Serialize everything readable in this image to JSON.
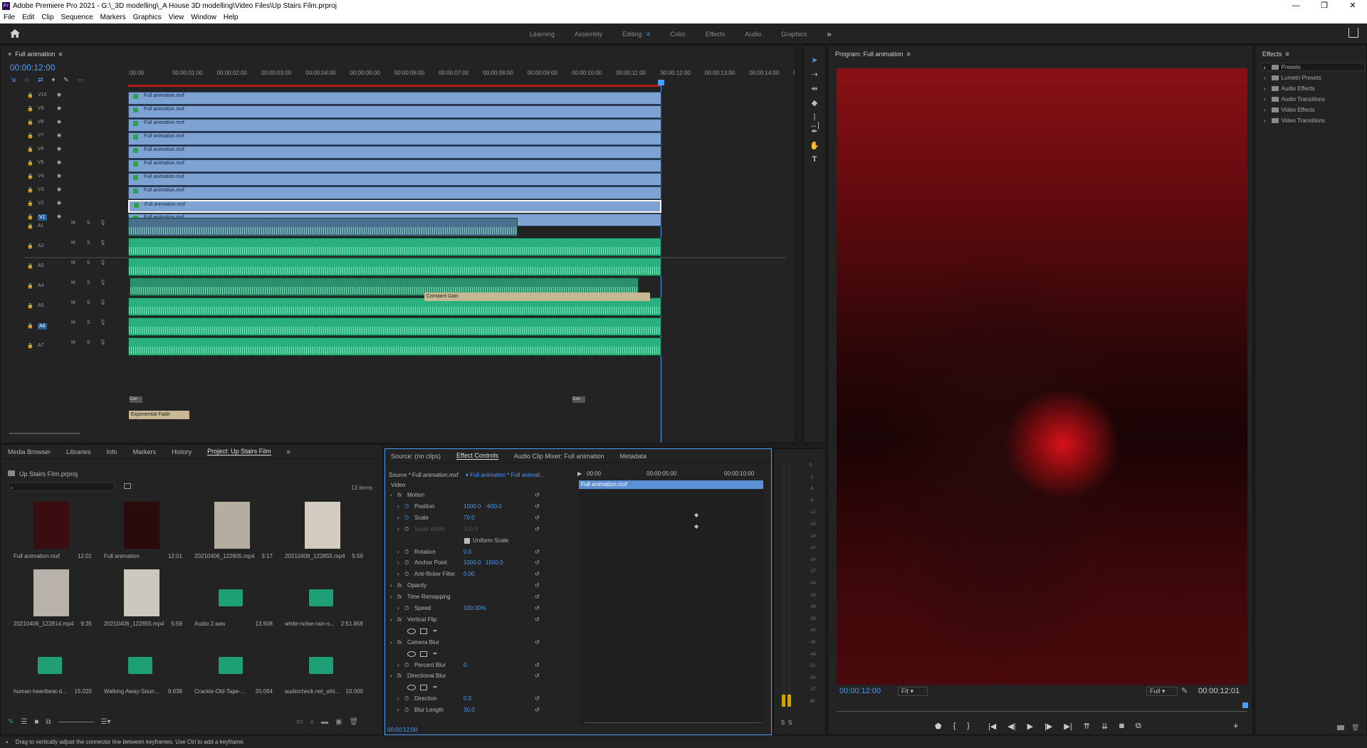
{
  "title_bar": {
    "title": "Adobe Premiere Pro 2021 - G:\\_3D modelling\\_A House 3D modelling\\Video Files\\Up Stairs Film.prproj",
    "app_badge": "Pr"
  },
  "window_controls": [
    "—",
    "❐",
    "✕"
  ],
  "menu": [
    "File",
    "Edit",
    "Clip",
    "Sequence",
    "Markers",
    "Graphics",
    "View",
    "Window",
    "Help"
  ],
  "workspaces": [
    {
      "label": "Learning"
    },
    {
      "label": "Assembly"
    },
    {
      "label": "Editing",
      "active": true
    },
    {
      "label": "Color"
    },
    {
      "label": "Effects"
    },
    {
      "label": "Audio"
    },
    {
      "label": "Graphics"
    }
  ],
  "timeline": {
    "sequence_tab": "Full animation",
    "timecode": "00:00:12:00",
    "ruler": [
      ":00:00",
      "00:00:01:00",
      "00:00:02:00",
      "00:00:03:00",
      "00:00:04:00",
      "00:00:05:00",
      "00:00:06:00",
      "00:00:07:00",
      "00:00:08:00",
      "00:00:09:00",
      "00:00:10:00",
      "00:00:11:00",
      "00:00:12:00",
      "00:00:13:00",
      "00:00:14:00",
      "00:"
    ],
    "video_tracks": [
      {
        "name": "V10",
        "clip": "Full animation.mxf"
      },
      {
        "name": "V9",
        "clip": "Full animation.mxf"
      },
      {
        "name": "V8",
        "clip": "Full animation.mxf"
      },
      {
        "name": "V7",
        "clip": "Full animation.mxf"
      },
      {
        "name": "V6",
        "clip": "Full animation.mxf"
      },
      {
        "name": "V5",
        "clip": "Full animation.mxf"
      },
      {
        "name": "V4",
        "clip": "Full animation.mxf"
      },
      {
        "name": "V3",
        "clip": "Full animation.mxf"
      },
      {
        "name": "V2",
        "clip": "Full animation.mxf"
      },
      {
        "name": "V1",
        "clip": "Full animation.mxf"
      }
    ],
    "audio_tracks": [
      "A1",
      "A2",
      "A3",
      "A4",
      "A5",
      "A6",
      "A7"
    ],
    "track_buttons": {
      "mute": "M",
      "solo": "S"
    },
    "transitions": {
      "a2": "Constant Gain",
      "a7": "Exponential Fade",
      "a6_left": "Con",
      "a6_right": "Con"
    }
  },
  "project": {
    "tabs": [
      "Media Browser",
      "Libraries",
      "Info",
      "Markers",
      "History",
      "Project: Up Stairs Film"
    ],
    "file": "Up Stairs Film.prproj",
    "count": "13 items",
    "items": [
      {
        "name": "Full animation.mxf",
        "dur": "12:01"
      },
      {
        "name": "Full animation",
        "dur": "12:01"
      },
      {
        "name": "20210406_122805.mp4",
        "dur": "3:17"
      },
      {
        "name": "20210406_122855.mp4",
        "dur": "5:59"
      },
      {
        "name": "20210406_122814.mp4",
        "dur": "9:35"
      },
      {
        "name": "20210406_122855.mp4",
        "dur": "5:59"
      },
      {
        "name": "Audio 2.wav",
        "dur": "13.908"
      },
      {
        "name": "white-noise-rain-s...",
        "dur": "2:51.859"
      },
      {
        "name": "human-heartbeat-d...",
        "dur": "15.020"
      },
      {
        "name": "Walking Away-Soun...",
        "dur": "9.638"
      },
      {
        "name": "Crackle-Old-Tape-...",
        "dur": "20.064"
      },
      {
        "name": "audiocheck.net_whi...",
        "dur": "10.000"
      }
    ]
  },
  "effect_controls": {
    "tabs": [
      "Source: (no clips)",
      "Effect Controls",
      "Audio Clip Mixer: Full animation",
      "Metadata"
    ],
    "source": "Source * Full animation.mxf",
    "target": "Full animation * Full animati...",
    "ruler": [
      "00:00",
      "00:00:05:00",
      "00:00:10:00"
    ],
    "clip_bar": "Full animation.mxf",
    "section": "Video",
    "rows": [
      {
        "label": "Motion",
        "kind": "fx"
      },
      {
        "label": "Position",
        "v1": "1000.0",
        "v2": "-600.0"
      },
      {
        "label": "Scale",
        "v1": "70.0"
      },
      {
        "label": "Scale Width",
        "v1": "100.0",
        "dim": true
      },
      {
        "label": "Uniform Scale",
        "kind": "check"
      },
      {
        "label": "Rotation",
        "v1": "0.0"
      },
      {
        "label": "Anchor Point",
        "v1": "1000.0",
        "v2": "1500.0"
      },
      {
        "label": "Anti-flicker Filter",
        "v1": "0.00"
      },
      {
        "label": "Opacity",
        "kind": "fx"
      },
      {
        "label": "Time Remapping",
        "kind": "fx"
      },
      {
        "label": "Speed",
        "v1": "100.00%"
      },
      {
        "label": "Vertical Flip",
        "kind": "fx"
      },
      {
        "label": "",
        "kind": "masks"
      },
      {
        "label": "Camera Blur",
        "kind": "fx"
      },
      {
        "label": "",
        "kind": "masks"
      },
      {
        "label": "Percent Blur",
        "v1": "0"
      },
      {
        "label": "Directional Blur",
        "kind": "fx"
      },
      {
        "label": "",
        "kind": "masks"
      },
      {
        "label": "Direction",
        "v1": "0.0"
      },
      {
        "label": "Blur Length",
        "v1": "30.0"
      }
    ],
    "footer_tc": "00:00:12:00"
  },
  "audio_meter": {
    "ticks": [
      "0",
      "-3",
      "-6",
      "-9",
      "-12",
      "-15",
      "-18",
      "-21",
      "-24",
      "-27",
      "-30",
      "-33",
      "-36",
      "-39",
      "-42",
      "-45",
      "-48",
      "-51",
      "-54",
      "-57",
      "dB"
    ],
    "solo": [
      "S",
      "S"
    ]
  },
  "program": {
    "title": "Program: Full animation",
    "timecode": "00:00:12:00",
    "fit": "Fit",
    "quality": "Full",
    "duration": "00:00:12:01"
  },
  "effects": {
    "title": "Effects",
    "folders": [
      "Presets",
      "Lumetri Presets",
      "Audio Effects",
      "Audio Transitions",
      "Video Effects",
      "Video Transitions"
    ]
  },
  "status": "Drag to vertically adjust the connector line between keyframes. Use Ctrl to add a keyframe.",
  "colors": {
    "accent": "#4b9cf5",
    "video_clip": "#7ea3d3",
    "audio_clip": "#2ab07d",
    "playhead": "#4b9cf5"
  }
}
